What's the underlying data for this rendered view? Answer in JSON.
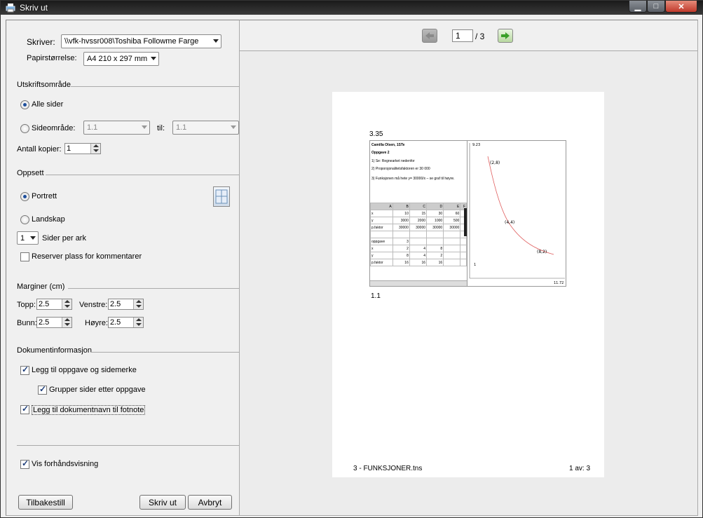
{
  "window": {
    "title": "Skriv ut"
  },
  "printer": {
    "label": "Skriver:",
    "value": "\\\\vfk-hvssr008\\Toshiba Followme Farge",
    "paper_label": "Papirstørrelse:",
    "paper_value": "A4 210 x 297 mm"
  },
  "range": {
    "group": "Utskriftsområde",
    "all_pages": "Alle sider",
    "page_range": "Sideområde:",
    "from_value": "1.1",
    "to_label": "til:",
    "to_value": "1.1",
    "copies_label": "Antall kopier:",
    "copies_value": "1"
  },
  "layout": {
    "group": "Oppsett",
    "portrait": "Portrett",
    "landscape": "Landskap",
    "pages_per_sheet_value": "1",
    "pages_per_sheet_label": "Sider per ark",
    "reserve_comments": "Reserver plass for kommentarer"
  },
  "margins": {
    "group": "Marginer (cm)",
    "top_label": "Topp:",
    "top_value": "2.5",
    "left_label": "Venstre:",
    "left_value": "2.5",
    "bottom_label": "Bunn:",
    "bottom_value": "2.5",
    "right_label": "Høyre:",
    "right_value": "2.5"
  },
  "docinfo": {
    "group": "Dokumentinformasjon",
    "add_problem": "Legg til oppgave og sidemerke",
    "group_pages": "Grupper sider etter oppgave",
    "add_docname": "Legg til dokumentnavn til fotnote"
  },
  "preview_toggle": "Vis forhåndsvisning",
  "buttons": {
    "reset": "Tilbakestill",
    "print": "Skriv ut",
    "cancel": "Avbryt"
  },
  "nav": {
    "page": "1",
    "total": "/ 3"
  },
  "preview": {
    "page_number": "3.35",
    "page_label": "1.1",
    "footer_left": "3 - FUNKSJONER.tns",
    "footer_right": "1 av: 3",
    "text_lines": [
      "Camilla Olsen, 1STe",
      "Oppgave 2",
      "1) Se: Regnearket nedenfor",
      "2) Proporsjonalitetsfaktoren er 30 000",
      "3) Funksjonen må hete y= 30000/x – se graf til høyre."
    ],
    "table": {
      "headers": [
        "A",
        "B",
        "C",
        "D",
        "E",
        "F"
      ],
      "rows": [
        [
          "x",
          "10",
          "15",
          "30",
          "60",
          ""
        ],
        [
          "y",
          "3000",
          "2000",
          "1000",
          "500",
          ""
        ],
        [
          "p.faktor",
          "30000",
          "30000",
          "30000",
          "30000",
          ""
        ],
        [
          "",
          "",
          "",
          "",
          "",
          ""
        ],
        [
          "oppgave",
          "3",
          "",
          "",
          "",
          ""
        ],
        [
          "x",
          "2",
          "4",
          "8",
          "",
          ""
        ],
        [
          "y",
          "8",
          "4",
          "2",
          "",
          ""
        ],
        [
          "p.faktor",
          "16",
          "16",
          "16",
          "",
          ""
        ]
      ]
    },
    "graph_labels": [
      "(2,8)",
      "(4,4)",
      "(8,2)"
    ],
    "graph_axis_top": "9.23",
    "graph_axis_right": "11.72",
    "graph_axis_left": "1"
  },
  "colors": {
    "curve": "#e06060",
    "check": "#1e3e7a",
    "next_arrow": "#3aa028"
  }
}
